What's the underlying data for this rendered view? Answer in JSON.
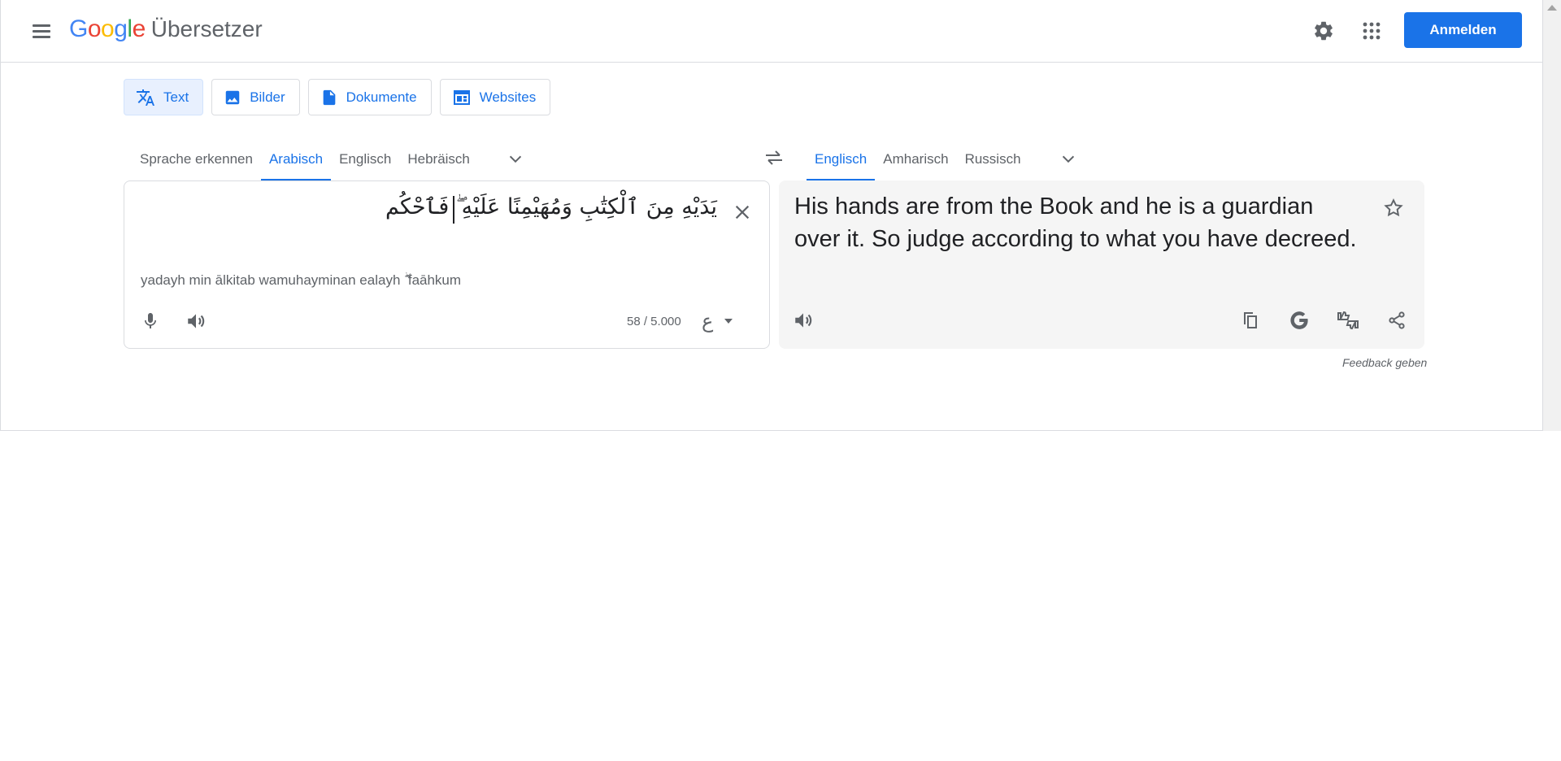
{
  "header": {
    "logo_letters": [
      "G",
      "o",
      "o",
      "g",
      "l",
      "e"
    ],
    "product_name": "Übersetzer",
    "signin_label": "Anmelden",
    "icons": [
      "menu-icon",
      "settings-icon",
      "apps-icon"
    ]
  },
  "modes": [
    {
      "label": "Text",
      "icon": "translate-icon",
      "active": true
    },
    {
      "label": "Bilder",
      "icon": "image-icon",
      "active": false
    },
    {
      "label": "Dokumente",
      "icon": "document-icon",
      "active": false
    },
    {
      "label": "Websites",
      "icon": "website-icon",
      "active": false
    }
  ],
  "source_langs": [
    {
      "label": "Sprache erkennen",
      "active": false
    },
    {
      "label": "Arabisch",
      "active": true
    },
    {
      "label": "Englisch",
      "active": false
    },
    {
      "label": "Hebräisch",
      "active": false
    }
  ],
  "target_langs": [
    {
      "label": "Englisch",
      "active": true
    },
    {
      "label": "Amharisch",
      "active": false
    },
    {
      "label": "Russisch",
      "active": false
    }
  ],
  "source": {
    "text": "يَدَيْهِ مِنَ ٱلْكِتَٰبِ وَمُهَيْمِنًا عَلَيْهِ ۖ فَٱحْكُم",
    "transliteration": "yadayh min ālkitab wamuhayminan ealayh ۖ faāhkum",
    "char_count": "58 / 5.000",
    "ime_glyph": "ع"
  },
  "target": {
    "text": "His hands are from the Book and he is a guardian over it. So judge according to what you have decreed."
  },
  "feedback_label": "Feedback geben",
  "colors": {
    "accent": "#1a73e8",
    "active_bg": "#e8f0fe",
    "target_panel_bg": "#f5f5f5",
    "text_secondary": "#5f6368",
    "border": "#dadce0"
  }
}
